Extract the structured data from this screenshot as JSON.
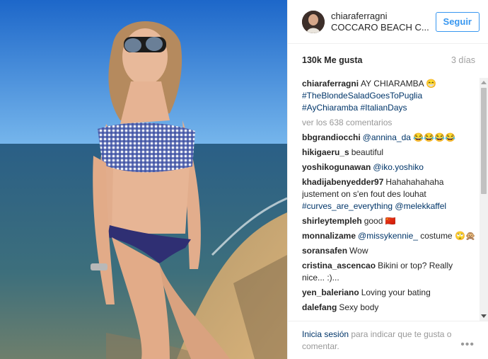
{
  "header": {
    "username": "chiaraferragni",
    "location": "COCCARO BEACH C...",
    "follow_label": "Seguir"
  },
  "stats": {
    "likes": "130k Me gusta",
    "time": "3 días"
  },
  "caption": {
    "user": "chiaraferragni",
    "text": "AY CHIARAMBA 😁",
    "hashtags": "#TheBlondeSaladGoesToPuglia #AyChiaramba #ItalianDays"
  },
  "view_all": "ver los 638 comentarios",
  "comments": [
    {
      "user": "bbgrandiocchi",
      "mention": "@annina_da",
      "text": " 😂😂😂😂"
    },
    {
      "user": "hikigaeru_s",
      "mention": "",
      "text": "beautiful"
    },
    {
      "user": "yoshikogunawan",
      "mention": "@iko.yoshiko",
      "text": ""
    },
    {
      "user": "khadijabenyedder97",
      "mention": "",
      "text": "Hahahahahaha justement on s'en fout des louhat",
      "tail_blue": "#curves_are_everything @melekkaffel"
    },
    {
      "user": "shirleytempleh",
      "mention": "",
      "text": "good 🇨🇳"
    },
    {
      "user": "monnalizame",
      "mention": "@missykennie_",
      "text": " costume 🙄🙊"
    },
    {
      "user": "soransafen",
      "mention": "",
      "text": "Wow"
    },
    {
      "user": "cristina_ascencao",
      "mention": "",
      "text": "Bikini or top? Really nice... :)..."
    },
    {
      "user": "yen_baleriano",
      "mention": "",
      "text": "Loving your bating"
    },
    {
      "user": "dalefang",
      "mention": "",
      "text": "Sexy body"
    }
  ],
  "footer": {
    "login_link": "Inicia sesión",
    "login_text": " para indicar que te gusta o comentar."
  },
  "icons": {
    "more": "more-options-icon"
  },
  "colors": {
    "link_blue": "#003569",
    "follow_blue": "#3897f0"
  }
}
